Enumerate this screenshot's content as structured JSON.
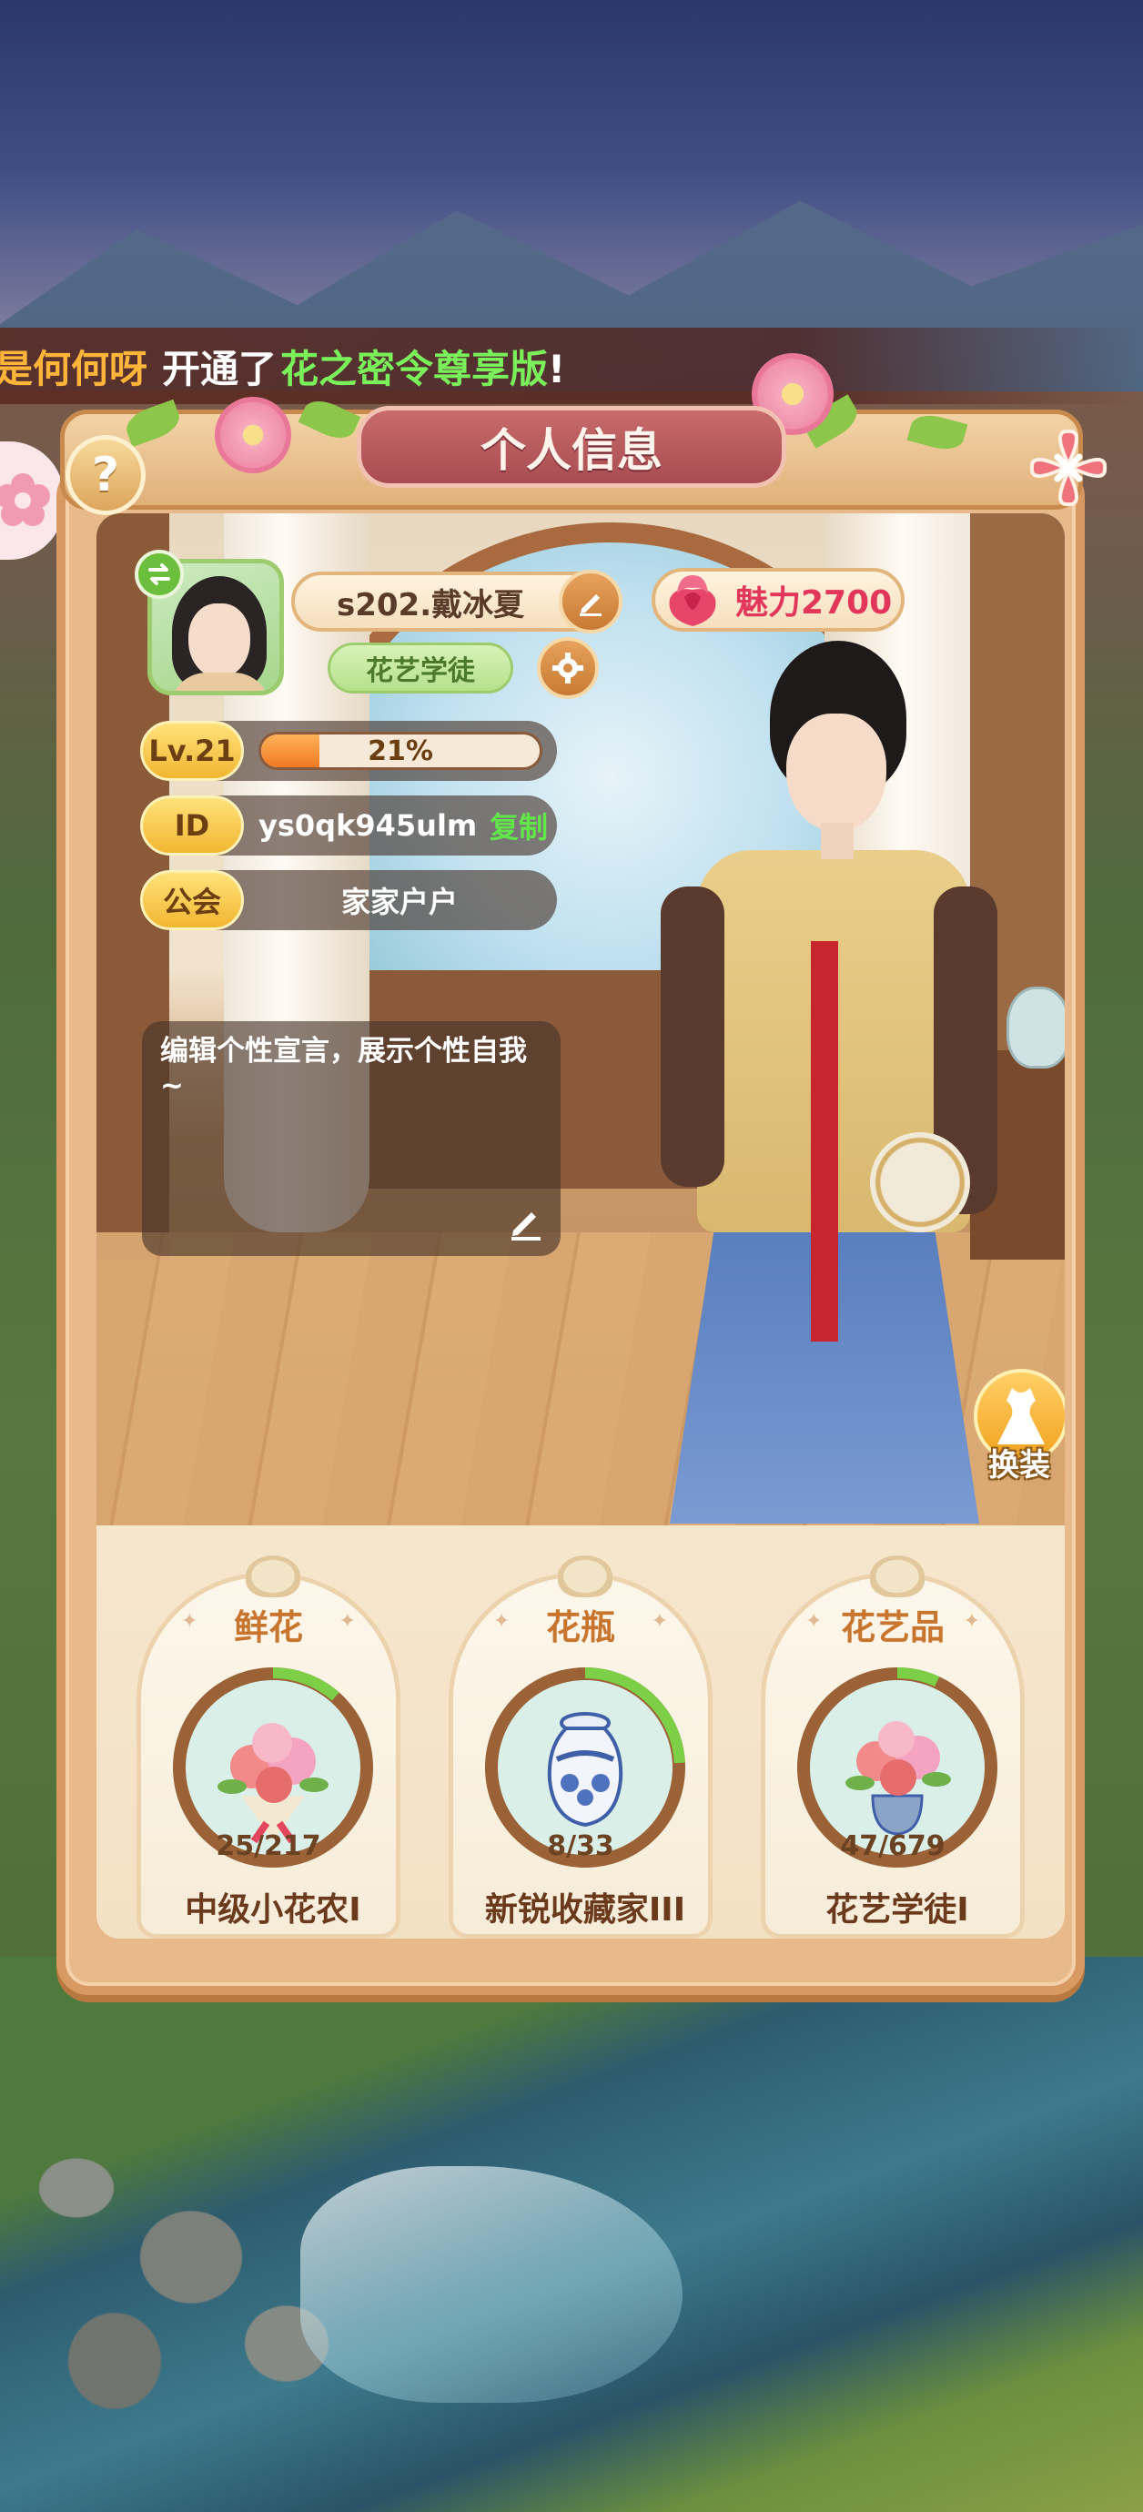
{
  "marquee": {
    "name": "是何何呀",
    "middle": "开通了",
    "item": "花之密令尊享版",
    "end": "!"
  },
  "header": {
    "title": "个人信息",
    "help_label": "?"
  },
  "profile": {
    "avatar_swap_icon": "swap-icon",
    "name": "s202.戴冰夏",
    "title_badge": "花艺学徒",
    "charm_label": "魅力2700",
    "level_tag": "Lv.21",
    "level_progress_text": "21%",
    "level_progress": 0.21,
    "id_tag": "ID",
    "id_value": "ys0qk945ulm",
    "copy_label": "复制",
    "guild_tag": "公会",
    "guild_name": "家家户户",
    "motto": "编辑个性宣言，展示个性自我~",
    "dress_label": "换装"
  },
  "collections": [
    {
      "title": "鲜花",
      "count_text": "25/217",
      "progress": 0.115,
      "rank": "中级小花农I",
      "icon": "bouquet-icon"
    },
    {
      "title": "花瓶",
      "count_text": "8/33",
      "progress": 0.242,
      "rank": "新锐收藏家III",
      "icon": "vase-icon"
    },
    {
      "title": "花艺品",
      "count_text": "47/679",
      "progress": 0.069,
      "rank": "花艺学徒I",
      "icon": "arrangement-icon"
    }
  ],
  "colors": {
    "accent_green": "#62e64a",
    "charm_pink": "#e2365a",
    "marquee_orange": "#ffb43a",
    "ring_green": "#7ccf46",
    "ring_brown": "#9a6236"
  }
}
